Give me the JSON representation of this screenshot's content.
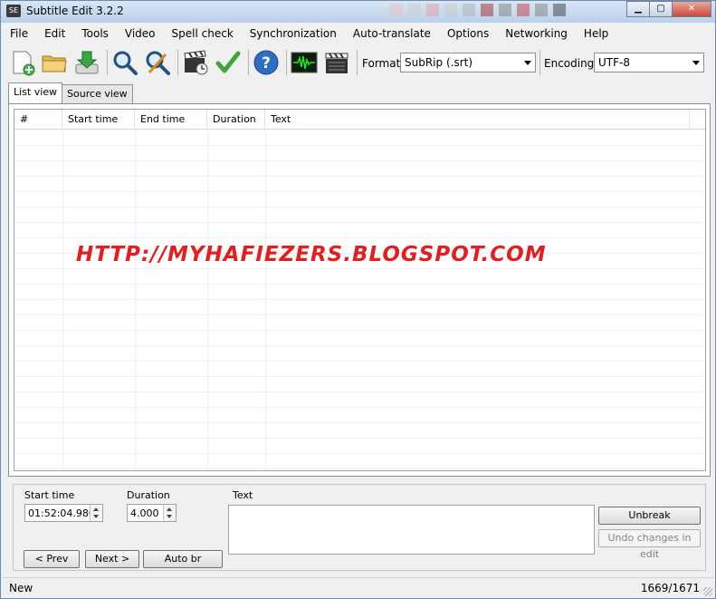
{
  "window": {
    "title": "Subtitle Edit 3.2.2",
    "icon_text": "SE"
  },
  "menu": [
    "File",
    "Edit",
    "Tools",
    "Video",
    "Spell check",
    "Synchronization",
    "Auto-translate",
    "Options",
    "Networking",
    "Help"
  ],
  "toolbar": {
    "icons": [
      "new-file-icon",
      "open-folder-icon",
      "download-icon",
      "find-icon",
      "replace-icon",
      "video-sync-icon",
      "spell-check-icon",
      "help-icon",
      "waveform-icon",
      "video-player-icon"
    ],
    "format_label": "Format",
    "format_value": "SubRip (.srt)",
    "encoding_label": "Encoding",
    "encoding_value": "UTF-8"
  },
  "tabs": [
    "List view",
    "Source view"
  ],
  "list": {
    "columns": [
      "#",
      "Start time",
      "End time",
      "Duration",
      "Text"
    ]
  },
  "watermark": "HTTP://MYHAFIEZERS.BLOGSPOT.COM",
  "editor": {
    "start_time_label": "Start time",
    "start_time_value": "01:52:04.980",
    "duration_label": "Duration",
    "duration_value": "4.000",
    "text_label": "Text",
    "prev_label": "< Prev",
    "next_label": "Next >",
    "auto_br_label": "Auto br",
    "unbreak_label": "Unbreak",
    "undo_label": "Undo changes in edit"
  },
  "status": {
    "left": "New",
    "right": "1669/1671"
  },
  "colors": {
    "accent": "#e41e1e",
    "title_bar": "#c9daee"
  }
}
